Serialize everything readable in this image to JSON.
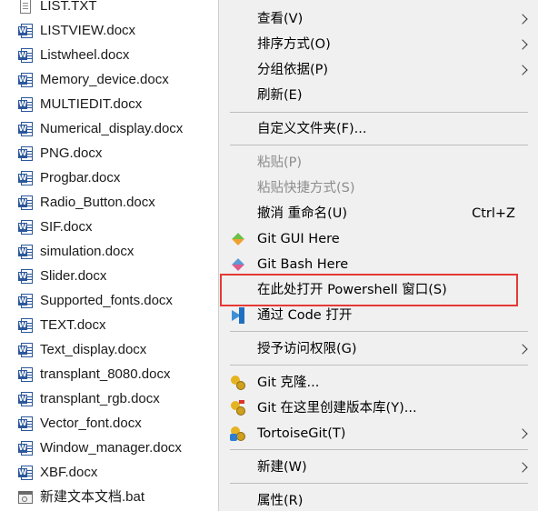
{
  "files": [
    {
      "name": "LIST.TXT",
      "icon": "text-file-icon"
    },
    {
      "name": "LISTVIEW.docx",
      "icon": "word-doc-icon"
    },
    {
      "name": "Listwheel.docx",
      "icon": "word-doc-icon"
    },
    {
      "name": "Memory_device.docx",
      "icon": "word-doc-icon"
    },
    {
      "name": "MULTIEDIT.docx",
      "icon": "word-doc-icon"
    },
    {
      "name": "Numerical_display.docx",
      "icon": "word-doc-icon"
    },
    {
      "name": "PNG.docx",
      "icon": "word-doc-icon"
    },
    {
      "name": "Progbar.docx",
      "icon": "word-doc-icon"
    },
    {
      "name": "Radio_Button.docx",
      "icon": "word-doc-icon"
    },
    {
      "name": "SIF.docx",
      "icon": "word-doc-icon"
    },
    {
      "name": "simulation.docx",
      "icon": "word-doc-icon"
    },
    {
      "name": "Slider.docx",
      "icon": "word-doc-icon"
    },
    {
      "name": "Supported_fonts.docx",
      "icon": "word-doc-icon"
    },
    {
      "name": "TEXT.docx",
      "icon": "word-doc-icon"
    },
    {
      "name": "Text_display.docx",
      "icon": "word-doc-icon"
    },
    {
      "name": "transplant_8080.docx",
      "icon": "word-doc-icon"
    },
    {
      "name": "transplant_rgb.docx",
      "icon": "word-doc-icon"
    },
    {
      "name": "Vector_font.docx",
      "icon": "word-doc-icon"
    },
    {
      "name": "Window_manager.docx",
      "icon": "word-doc-icon"
    },
    {
      "name": "XBF.docx",
      "icon": "word-doc-icon"
    },
    {
      "name": "新建文本文档.bat",
      "icon": "batch-file-icon"
    }
  ],
  "menu": {
    "view": {
      "label": "查看(V)"
    },
    "sort_by": {
      "label": "排序方式(O)"
    },
    "group_by": {
      "label": "分组依据(P)"
    },
    "refresh": {
      "label": "刷新(E)"
    },
    "customize_folder": {
      "label": "自定义文件夹(F)..."
    },
    "paste": {
      "label": "粘贴(P)"
    },
    "paste_shortcut": {
      "label": "粘贴快捷方式(S)"
    },
    "undo_rename": {
      "label": "撤消 重命名(U)",
      "shortcut": "Ctrl+Z"
    },
    "git_gui": {
      "label": "Git GUI Here"
    },
    "git_bash": {
      "label": "Git Bash Here"
    },
    "open_powershell": {
      "label": "在此处打开 Powershell 窗口(S)"
    },
    "open_vscode": {
      "label": "通过 Code 打开"
    },
    "grant_access": {
      "label": "授予访问权限(G)"
    },
    "git_clone": {
      "label": "Git 克隆..."
    },
    "git_create_repo": {
      "label": "Git 在这里创建版本库(Y)..."
    },
    "tortoisegit": {
      "label": "TortoiseGit(T)"
    },
    "new": {
      "label": "新建(W)"
    },
    "properties": {
      "label": "属性(R)"
    }
  },
  "colors": {
    "menu_background": "#f0f0f0",
    "highlight_border": "#e53935",
    "disabled_text": "#8c8c8c",
    "word_blue": "#2b579a"
  }
}
